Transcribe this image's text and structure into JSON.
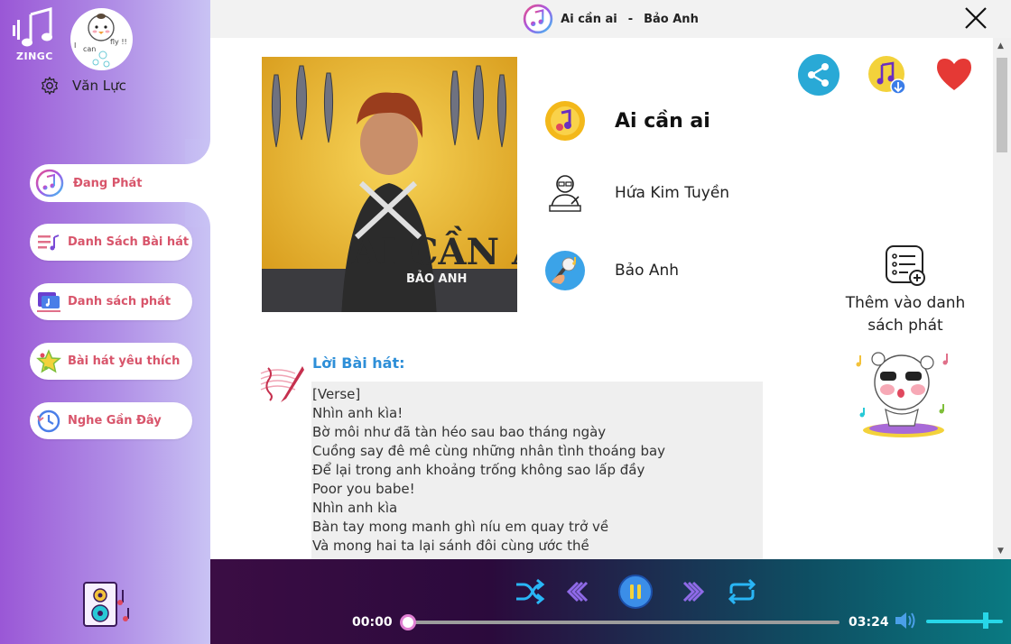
{
  "app": {
    "logo_text": "ZINGC",
    "user_name": "Văn Lực"
  },
  "sidebar": {
    "items": [
      {
        "label": "Đang Phát"
      },
      {
        "label": "Danh Sách Bài hát"
      },
      {
        "label": "Danh sách phát"
      },
      {
        "label": "Bài hát yêu thích"
      },
      {
        "label": "Nghe Gần Đây"
      }
    ]
  },
  "titlebar": {
    "song": "Ai cần ai",
    "separator": "-",
    "artist": "Bảo Anh"
  },
  "song_info": {
    "title": "Ai cần ai",
    "composer": "Hứa Kim Tuyền",
    "singer": "Bảo Anh",
    "cover_text_1": "AI CẦN AI",
    "cover_text_2": "BẢO ANH"
  },
  "actions": {
    "add_to_playlist": "Thêm vào danh sách phát"
  },
  "lyrics": {
    "heading": "Lời Bài hát:",
    "lines": [
      "[Verse]",
      "Nhìn anh kìa!",
      "Bờ môi như đã tàn héo sau bao tháng ngày",
      "Cuồng say đê mê cùng những nhân tình thoáng bay",
      "Để lại trong anh khoảng trống không sao lấp đầy",
      "Poor you babe!",
      "Nhìn anh kìa",
      "Bàn tay mong manh ghì níu em quay trở về",
      "Và mong hai ta lại sánh đôi cùng ước thề"
    ]
  },
  "player": {
    "current_time": "00:00",
    "total_time": "03:24",
    "progress": 0.0,
    "volume": 0.78
  },
  "colors": {
    "accent_pink": "#d8556b",
    "lyrics_blue": "#2e8fd8",
    "share_blue": "#29a9d6",
    "heart_red": "#e53935"
  }
}
